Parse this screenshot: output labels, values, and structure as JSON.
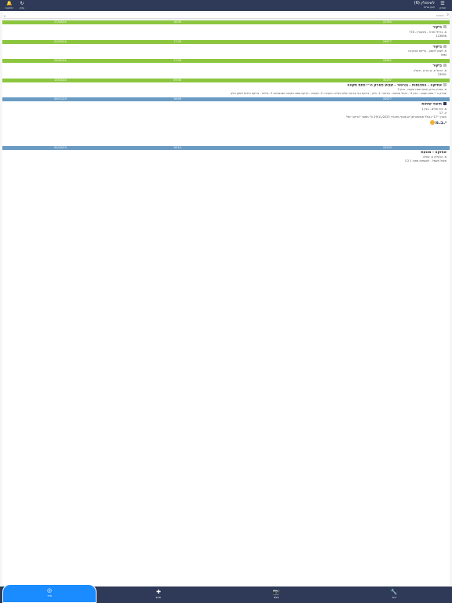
{
  "topbar": {
    "title": "לשימולין (6)",
    "subtitle": "קבע אירוח",
    "menu_label": "תפריט",
    "refresh_label": "עדכן",
    "bell_label": "התראות"
  },
  "filter": {
    "placeholder": "חיפוש"
  },
  "entries": [
    {
      "color": "green",
      "id": "22394",
      "time": "16:35",
      "date": "27/03/24",
      "title": "ביקור",
      "lines": [
        "מ. ברזילי מזרח - אינשטיין - 778",
        "123656"
      ]
    },
    {
      "color": "green",
      "id": "29877",
      "time": "17:30",
      "date": "20/03/24",
      "title": "ביקור",
      "lines": [
        "מ. ויצמן לוינסון - בדיקת אינטרנט",
        "test"
      ]
    },
    {
      "color": "green",
      "id": "29891",
      "time": "17:43",
      "date": "28/02/24",
      "title": "ביקור",
      "lines": [
        "מ. הרצל פ. בן גוריון - תקלה",
        "23091"
      ]
    },
    {
      "color": "green",
      "id": "30297",
      "time": "09:30",
      "date": "13/02/24",
      "title": "אחזקה - התכנסות - גנרטור - שבוע פארק ה״י פתח תקווה",
      "lines": [
        "מ. פארק הידע, מבוא פתח תקווה - בניין 3",
        "פארק ה״י פתח תקווה - בניין 3 - ביטול אבטוס - גנרטור: 1. הלון - בדיקת גוף גנרטור שלא בעליה הטעינה. 2. תקינות - בדיקת מצב תקינות המנגנונים. 3. נזילות - בדיקת נזילות לשמן ודלק"
      ]
    },
    {
      "color": "blue",
      "id": "20477",
      "time": "16:05",
      "date": "29/11/23",
      "title": "תיעוד שיחות",
      "lines": [
        "מ. בית חולים - בניין 1",
        "ק. 17",
        "הצורך \"17\" (בגלל מפוסטרים) יש מוסף בתאריך 29/11/2023 ע\"י ממסך \"בדיקה יזמי\""
      ],
      "logo": "י.ב.מ"
    },
    {
      "color": "blue",
      "id": "20233",
      "time": "16:14",
      "date": "04/10/23",
      "title": "אחזקה - מונעת",
      "lines": [
        "מ. הרצליה פ. אחלה",
        "פיצול חשמל - לפעמיות מוקד 1 2 3"
      ]
    }
  ],
  "tabs": [
    {
      "label": "כיור",
      "icon": "wrench-icon"
    },
    {
      "label": "צלם",
      "icon": "camera-icon"
    },
    {
      "label": "חדש",
      "icon": "plus-icon"
    },
    {
      "label": "סייר",
      "icon": "patrol-icon"
    }
  ],
  "colors": {
    "nav": "#2e3a57",
    "green": "#8cc63f",
    "blue": "#6a9bc3",
    "active_tab": "#1a8cff"
  }
}
